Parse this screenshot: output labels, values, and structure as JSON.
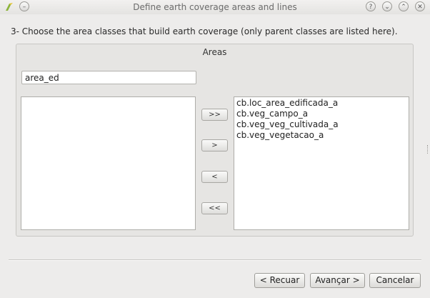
{
  "window": {
    "title": "Define earth coverage areas and lines",
    "controls": [
      {
        "name": "help",
        "glyph": "?"
      },
      {
        "name": "minimize",
        "glyph": "⌄"
      },
      {
        "name": "maximize",
        "glyph": "⌃"
      },
      {
        "name": "close",
        "glyph": "✕"
      }
    ]
  },
  "instruction": "3- Choose the area classes that build earth coverage (only parent classes are listed here).",
  "areas": {
    "title": "Areas",
    "filter_value": "area_ed",
    "available_items": [],
    "selected_items": [
      "cb.loc_area_edificada_a",
      "cb.veg_campo_a",
      "cb.veg_veg_cultivada_a",
      "cb.veg_vegetacao_a"
    ],
    "buttons": {
      "add_all": ">>",
      "add": ">",
      "remove": "<",
      "remove_all": "<<"
    }
  },
  "footer": {
    "back_label": "< Recuar",
    "next_label": "Avançar >",
    "cancel_label": "Cancelar"
  }
}
